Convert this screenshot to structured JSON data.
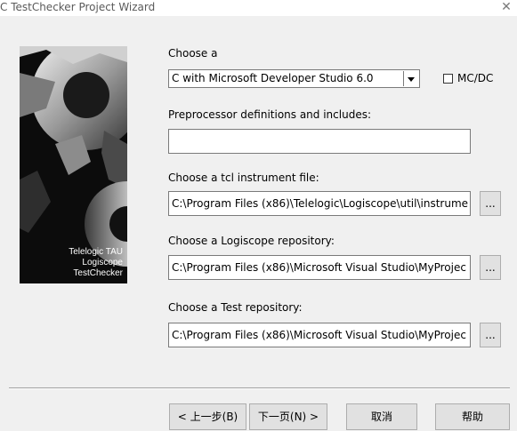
{
  "window": {
    "title": "C TestChecker Project Wizard",
    "close_glyph": "✕"
  },
  "side_image": {
    "brand_line1": "Telelogic TAU",
    "brand_line2": "Logiscope",
    "brand_line3": "TestChecker"
  },
  "form": {
    "choose_label": "Choose a",
    "environment_value": "C with Microsoft Developer Studio 6.0",
    "mcdc_label": "MC/DC",
    "mcdc_checked": false,
    "preproc_label": "Preprocessor definitions and includes:",
    "preproc_value": "",
    "tcl_label": "Choose a tcl instrument file:",
    "tcl_value": "C:\\Program Files (x86)\\Telelogic\\Logiscope\\util\\instrume",
    "logiscope_label": "Choose a Logiscope repository:",
    "logiscope_value": "C:\\Program Files (x86)\\Microsoft Visual Studio\\MyProjec",
    "test_label": "Choose a Test repository:",
    "test_value": "C:\\Program Files (x86)\\Microsoft Visual Studio\\MyProjec",
    "browse_label": "..."
  },
  "buttons": {
    "back": "< 上一步(B)",
    "next": "下一页(N) >",
    "cancel": "取消",
    "help": "帮助"
  },
  "icons": {
    "close": "close-icon",
    "dropdown": "chevron-down-icon"
  }
}
